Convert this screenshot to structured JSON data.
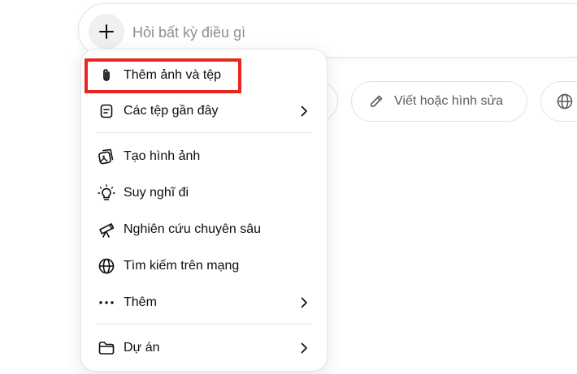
{
  "composer": {
    "placeholder": "Hỏi bất kỳ điều gì"
  },
  "chips": [
    {
      "label": "Viết hoặc hình sửa",
      "icon": "pencil-icon"
    },
    {
      "label": "",
      "icon": "globe-icon"
    }
  ],
  "menu": {
    "items": [
      {
        "label": "Thêm ảnh và tệp",
        "icon": "paperclip-icon",
        "submenu": false,
        "highlighted": true
      },
      {
        "label": "Các tệp gần đây",
        "icon": "file-icon",
        "submenu": true
      },
      {
        "label": "Tạo hình ảnh",
        "icon": "image-icon",
        "submenu": false
      },
      {
        "label": "Suy nghĩ đi",
        "icon": "lightbulb-icon",
        "submenu": false
      },
      {
        "label": "Nghiên cứu chuyên sâu",
        "icon": "telescope-icon",
        "submenu": false
      },
      {
        "label": "Tìm kiếm trên mạng",
        "icon": "globe-icon",
        "submenu": false
      },
      {
        "label": "Thêm",
        "icon": "more-dots-icon",
        "submenu": true
      },
      {
        "label": "Dự án",
        "icon": "folder-icon",
        "submenu": true
      }
    ]
  },
  "colors": {
    "highlight": "#e8261e",
    "text": "#0d0d0d",
    "placeholder": "#8f8f8f",
    "border": "#e3e3e3"
  }
}
